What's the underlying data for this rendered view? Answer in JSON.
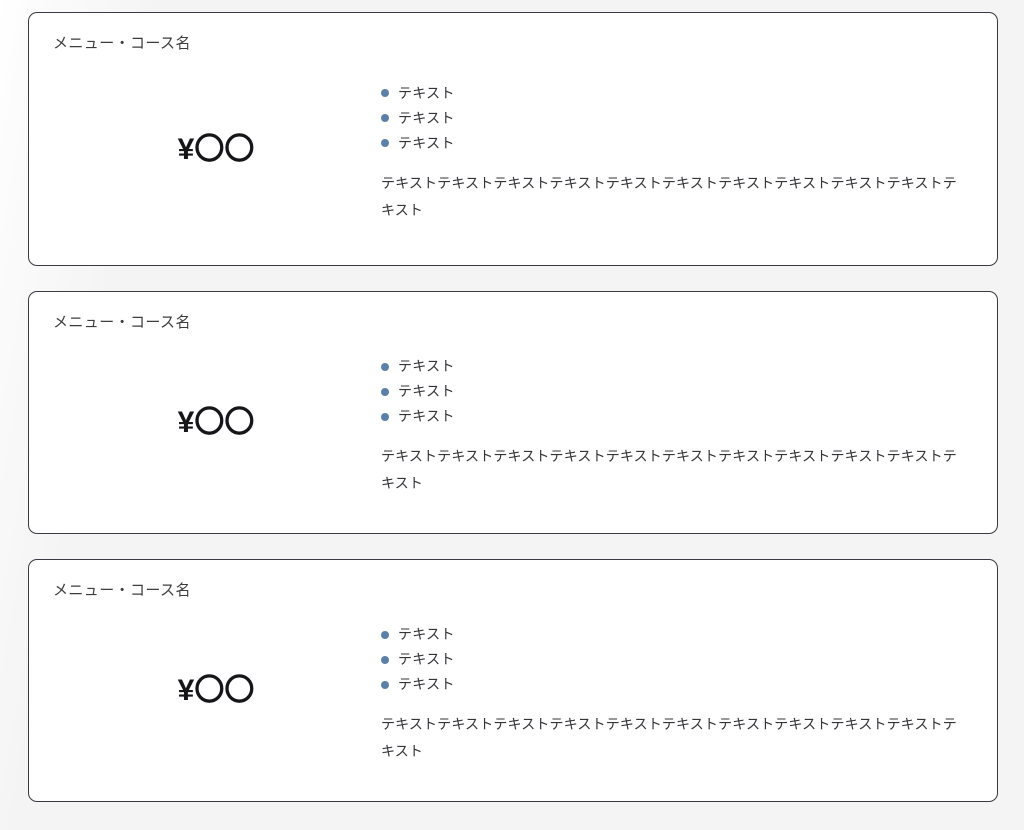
{
  "background_color": "#f4f4f4",
  "card_border_color": "#3a3a42",
  "card_background": "#ffffff",
  "bullet_color": "#5c7fa8",
  "text_color": "#333338",
  "price_color": "#15151a",
  "cards": [
    {
      "title": "メニュー・コース名",
      "price": "¥〇〇",
      "features": [
        "テキスト",
        "テキスト",
        "テキスト"
      ],
      "description": "テキストテキストテキストテキストテキストテキストテキストテキストテキストテキストテキスト"
    },
    {
      "title": "メニュー・コース名",
      "price": "¥〇〇",
      "features": [
        "テキスト",
        "テキスト",
        "テキスト"
      ],
      "description": "テキストテキストテキストテキストテキストテキストテキストテキストテキストテキストテキスト"
    },
    {
      "title": "メニュー・コース名",
      "price": "¥〇〇",
      "features": [
        "テキスト",
        "テキスト",
        "テキスト"
      ],
      "description": "テキストテキストテキストテキストテキストテキストテキストテキストテキストテキストテキスト"
    }
  ]
}
